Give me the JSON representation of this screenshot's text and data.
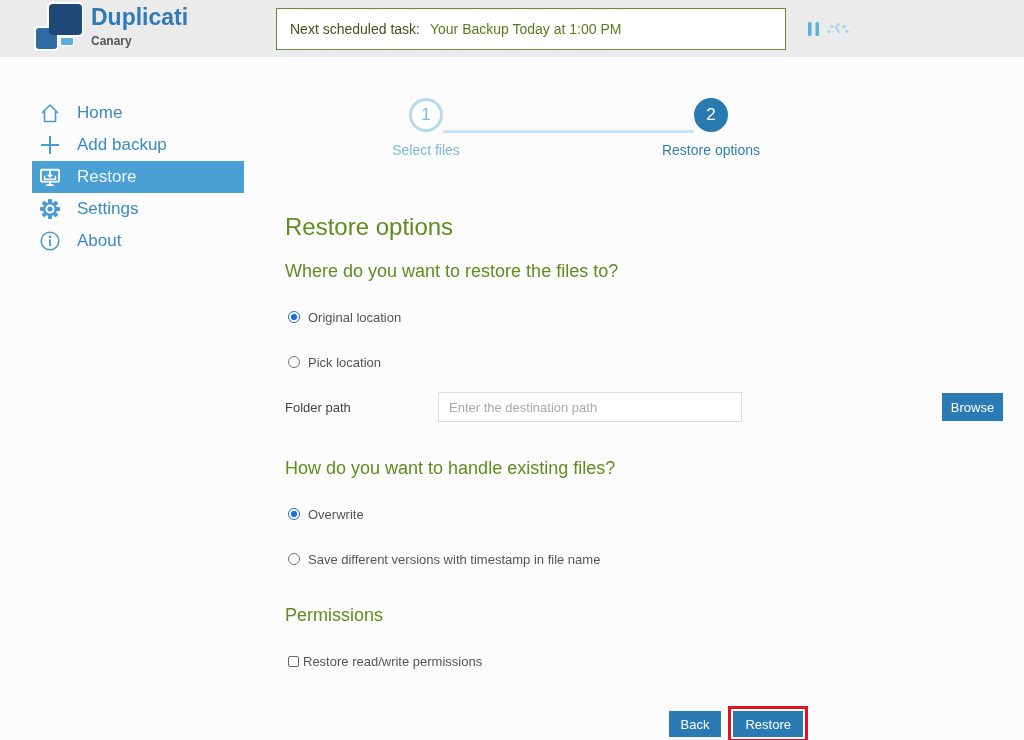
{
  "header": {
    "brand": {
      "name": "Duplicati",
      "edition": "Canary"
    },
    "schedule": {
      "label": "Next scheduled task:",
      "value": "Your Backup Today at 1:00 PM"
    }
  },
  "sidebar": {
    "items": [
      {
        "label": "Home",
        "kind": "home",
        "selected": false
      },
      {
        "label": "Add backup",
        "kind": "add",
        "selected": false
      },
      {
        "label": "Restore",
        "kind": "restore",
        "selected": true
      },
      {
        "label": "Settings",
        "kind": "settings",
        "selected": false
      },
      {
        "label": "About",
        "kind": "about",
        "selected": false
      }
    ]
  },
  "stepper": {
    "steps": [
      {
        "number": "1",
        "label": "Select files",
        "selected": false
      },
      {
        "number": "2",
        "label": "Restore options",
        "selected": true
      }
    ]
  },
  "form": {
    "title": "Restore options",
    "sections": [
      {
        "heading": "Where do you want to restore the files to?",
        "options": [
          {
            "kind": "radio",
            "label": "Original location",
            "selected": true
          },
          {
            "kind": "radio",
            "label": "Pick location",
            "selected": false
          }
        ],
        "field": {
          "label": "Folder path",
          "placeholder": "Enter the destination path",
          "button": "Browse"
        }
      },
      {
        "heading": "How do you want to handle existing files?",
        "options": [
          {
            "kind": "radio",
            "label": "Overwrite",
            "selected": true
          },
          {
            "kind": "radio",
            "label": "Save different versions with timestamp in file name",
            "selected": false
          }
        ]
      },
      {
        "heading": "Permissions",
        "options": [
          {
            "kind": "checkbox",
            "label": "Restore read/write permissions",
            "checked": false
          }
        ]
      }
    ]
  },
  "buttons": [
    {
      "label": "Back",
      "highlighted": false
    },
    {
      "label": "Restore",
      "highlighted": true
    }
  ]
}
